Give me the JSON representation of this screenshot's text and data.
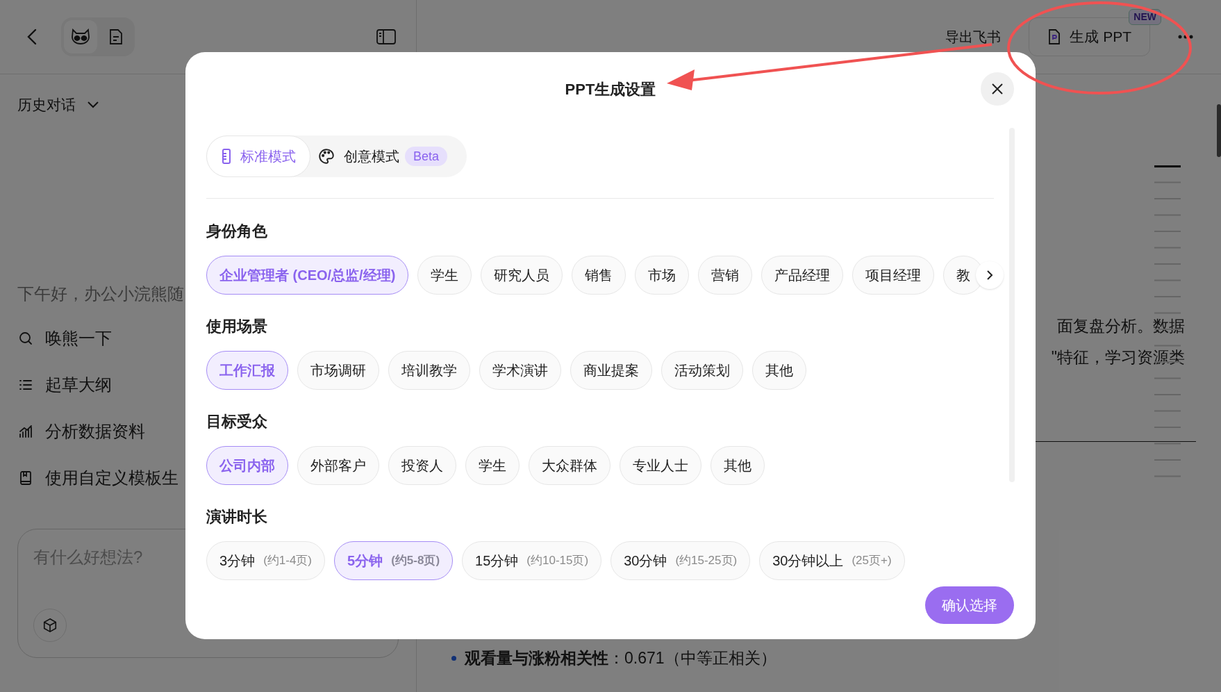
{
  "sidebar": {
    "history_label": "历史对话",
    "greeting": "下午好，办公小浣熊随",
    "actions": [
      {
        "label": "唤熊一下",
        "kind": "search"
      },
      {
        "label": "起草大纲",
        "kind": "list"
      },
      {
        "label": "分析数据资料",
        "kind": "chart"
      },
      {
        "label": "使用自定义模板生",
        "kind": "template"
      }
    ],
    "input": {
      "placeholder": "有什么好想法?"
    }
  },
  "header": {
    "export_label": "导出飞书",
    "generate_button": {
      "label": "生成 PPT",
      "badge": "NEW"
    }
  },
  "document": {
    "lines": [
      "面复盘分析。数据",
      "\"特征，学习资源类"
    ],
    "bullet": "**观看量与涨粉相关性**：0.671（中等正相关）"
  },
  "dialog": {
    "title": "PPT生成设置",
    "modes": [
      {
        "label": "标准模式",
        "kind": "standard",
        "selected": true
      },
      {
        "label": "创意模式",
        "kind": "creative",
        "selected": false,
        "badge": "Beta"
      }
    ],
    "sections": [
      {
        "heading": "身份角色",
        "more": true,
        "options": [
          {
            "label": "企业管理者 (CEO/总监/经理)",
            "selected": true
          },
          {
            "label": "学生",
            "selected": false
          },
          {
            "label": "研究人员",
            "selected": false
          },
          {
            "label": "销售",
            "selected": false
          },
          {
            "label": "市场",
            "selected": false
          },
          {
            "label": "营销",
            "selected": false
          },
          {
            "label": "产品经理",
            "selected": false
          },
          {
            "label": "项目经理",
            "selected": false
          },
          {
            "label": "教",
            "selected": false
          }
        ]
      },
      {
        "heading": "使用场景",
        "options": [
          {
            "label": "工作汇报",
            "selected": true
          },
          {
            "label": "市场调研",
            "selected": false
          },
          {
            "label": "培训教学",
            "selected": false
          },
          {
            "label": "学术演讲",
            "selected": false
          },
          {
            "label": "商业提案",
            "selected": false
          },
          {
            "label": "活动策划",
            "selected": false
          },
          {
            "label": "其他",
            "selected": false
          }
        ]
      },
      {
        "heading": "目标受众",
        "options": [
          {
            "label": "公司内部",
            "selected": true
          },
          {
            "label": "外部客户",
            "selected": false
          },
          {
            "label": "投资人",
            "selected": false
          },
          {
            "label": "学生",
            "selected": false
          },
          {
            "label": "大众群体",
            "selected": false
          },
          {
            "label": "专业人士",
            "selected": false
          },
          {
            "label": "其他",
            "selected": false
          }
        ]
      },
      {
        "heading": "演讲时长",
        "options": [
          {
            "label": "3分钟",
            "note": "(约1-4页)",
            "selected": false
          },
          {
            "label": "5分钟",
            "note": "(约5-8页)",
            "selected": true
          },
          {
            "label": "15分钟",
            "note": "(约10-15页)",
            "selected": false
          },
          {
            "label": "30分钟",
            "note": "(约15-25页)",
            "selected": false
          },
          {
            "label": "30分钟以上",
            "note": "(25页+)",
            "selected": false
          }
        ]
      }
    ],
    "confirm_button": "确认选择"
  }
}
